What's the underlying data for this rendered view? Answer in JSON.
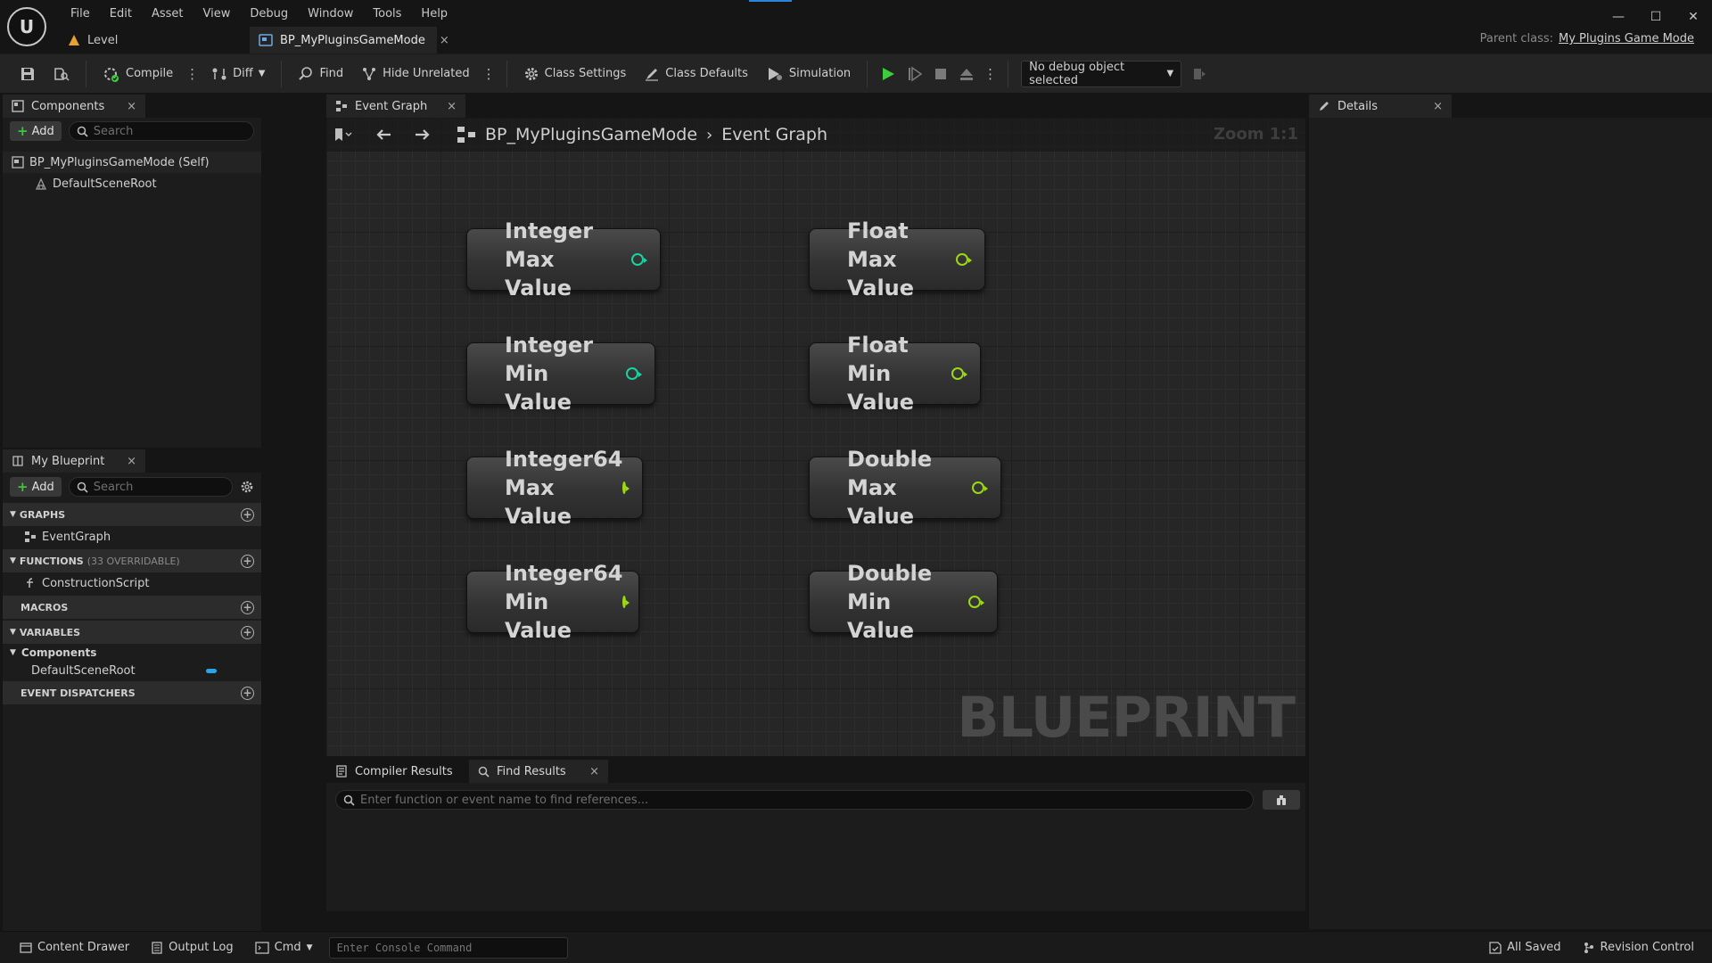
{
  "menu": [
    "File",
    "Edit",
    "Asset",
    "View",
    "Debug",
    "Window",
    "Tools",
    "Help"
  ],
  "tabs": {
    "level": "Level",
    "blueprint": "BP_MyPluginsGameMode"
  },
  "parent_class": {
    "label": "Parent class:",
    "value": "My Plugins Game Mode"
  },
  "toolbar": {
    "compile": "Compile",
    "diff": "Diff",
    "find": "Find",
    "hide_unrelated": "Hide Unrelated",
    "class_settings": "Class Settings",
    "class_defaults": "Class Defaults",
    "simulation": "Simulation",
    "debug_object": "No debug object selected"
  },
  "components": {
    "title": "Components",
    "add": "Add",
    "search_placeholder": "Search",
    "tree": [
      "BP_MyPluginsGameMode (Self)",
      "DefaultSceneRoot"
    ]
  },
  "my_blueprint": {
    "title": "My Blueprint",
    "add": "Add",
    "search_placeholder": "Search",
    "graphs_label": "GRAPHS",
    "graphs": [
      "EventGraph"
    ],
    "functions_label": "FUNCTIONS",
    "functions_sub": "(33 OVERRIDABLE)",
    "functions": [
      "ConstructionScript"
    ],
    "macros_label": "MACROS",
    "variables_label": "VARIABLES",
    "variables_group": "Components",
    "variables": [
      "DefaultSceneRoot"
    ],
    "dispatchers_label": "EVENT DISPATCHERS"
  },
  "graph": {
    "tab": "Event Graph",
    "breadcrumb": [
      "BP_MyPluginsGameMode",
      "Event Graph"
    ],
    "zoom": "Zoom 1:1",
    "watermark": "BLUEPRINT",
    "nodes": [
      {
        "line1": "Integer Max",
        "line2": "Value",
        "pin": "teal"
      },
      {
        "line1": "Float Max",
        "line2": "Value",
        "pin": "green"
      },
      {
        "line1": "Integer Min",
        "line2": "Value",
        "pin": "teal"
      },
      {
        "line1": "Float Min",
        "line2": "Value",
        "pin": "green"
      },
      {
        "line1": "Integer64",
        "line2": "Max Value",
        "pin": "green"
      },
      {
        "line1": "Double Max",
        "line2": "Value",
        "pin": "green"
      },
      {
        "line1": "Integer64",
        "line2": "Min Value",
        "pin": "green"
      },
      {
        "line1": "Double Min",
        "line2": "Value",
        "pin": "green"
      }
    ]
  },
  "bottom": {
    "compiler_results": "Compiler Results",
    "find_results": "Find Results",
    "find_placeholder": "Enter function or event name to find references..."
  },
  "details": {
    "title": "Details"
  },
  "statusbar": {
    "content_drawer": "Content Drawer",
    "output_log": "Output Log",
    "cmd": "Cmd",
    "console_placeholder": "Enter Console Command",
    "saved": "All Saved",
    "revision": "Revision Control"
  },
  "colors": {
    "accent": "#2a84d8",
    "play": "#3ecb3e",
    "pin_green": "#9bd816",
    "pin_teal": "#17d4a0"
  }
}
